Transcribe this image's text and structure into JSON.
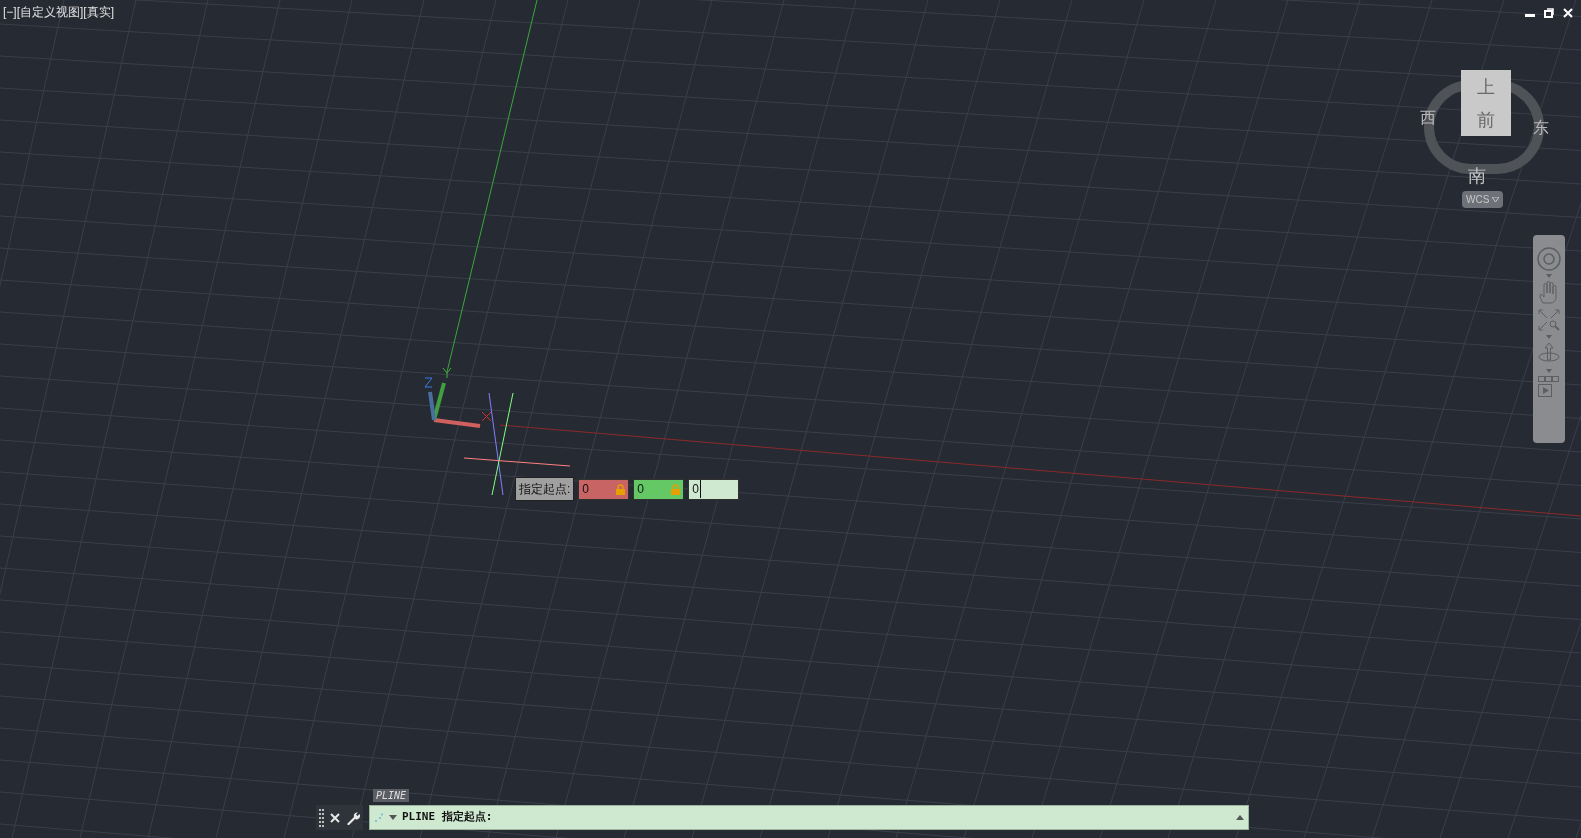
{
  "viewport_label": "[−][自定义视图][真实]",
  "viewcube": {
    "top_face": "上",
    "front_face": "前",
    "compass": {
      "west": "西",
      "east": "东",
      "south": "南"
    },
    "ucs_menu": "WCS"
  },
  "dynamic_input": {
    "prompt": "指定起点:",
    "fields": [
      {
        "value": "0",
        "locked": true,
        "color": "#c86464"
      },
      {
        "value": "0",
        "locked": true,
        "color": "#64c864"
      },
      {
        "value": "0",
        "locked": false,
        "color": "#cfe8d0"
      }
    ]
  },
  "command_line": {
    "history": "PLINE",
    "input": "PLINE 指定起点:"
  }
}
